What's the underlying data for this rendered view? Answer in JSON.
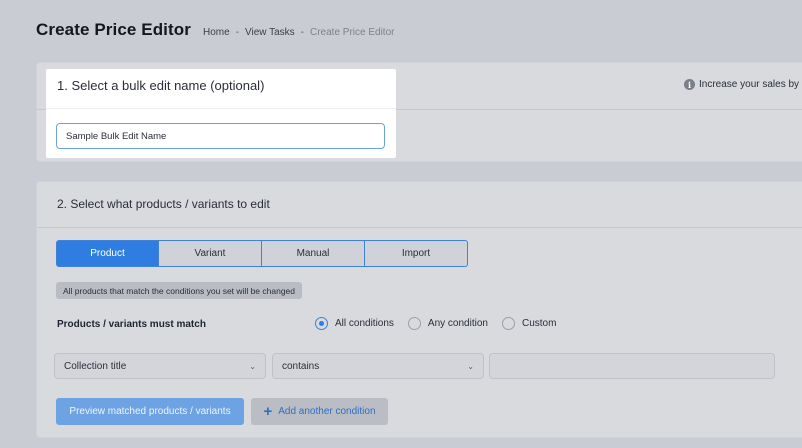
{
  "header": {
    "title": "Create Price Editor",
    "breadcrumb": {
      "home": "Home",
      "tasks": "View Tasks",
      "current": "Create Price Editor",
      "separator": "-"
    }
  },
  "section1": {
    "title": "1. Select a bulk edit name (optional)",
    "input_value": "Sample Bulk Edit Name",
    "info_text": "Increase your sales by"
  },
  "section2": {
    "title": "2. Select what products / variants to edit",
    "tabs": [
      {
        "label": "Product",
        "active": true
      },
      {
        "label": "Variant",
        "active": false
      },
      {
        "label": "Manual",
        "active": false
      },
      {
        "label": "Import",
        "active": false
      }
    ],
    "hint": "All products that match the conditions you set will be changed",
    "match_label": "Products / variants must match",
    "match_options": [
      {
        "label": "All conditions",
        "checked": true
      },
      {
        "label": "Any condition",
        "checked": false
      },
      {
        "label": "Custom",
        "checked": false
      }
    ],
    "condition": {
      "field": "Collection title",
      "operator": "contains",
      "value": ""
    },
    "preview_button": "Preview matched products / variants",
    "add_button": "Add another condition"
  },
  "icons": {
    "info": "info-icon",
    "plus": "plus-icon",
    "chevron": "chevron-down-icon"
  },
  "colors": {
    "accent": "#2f7de0",
    "background": "#c9ccd2"
  }
}
